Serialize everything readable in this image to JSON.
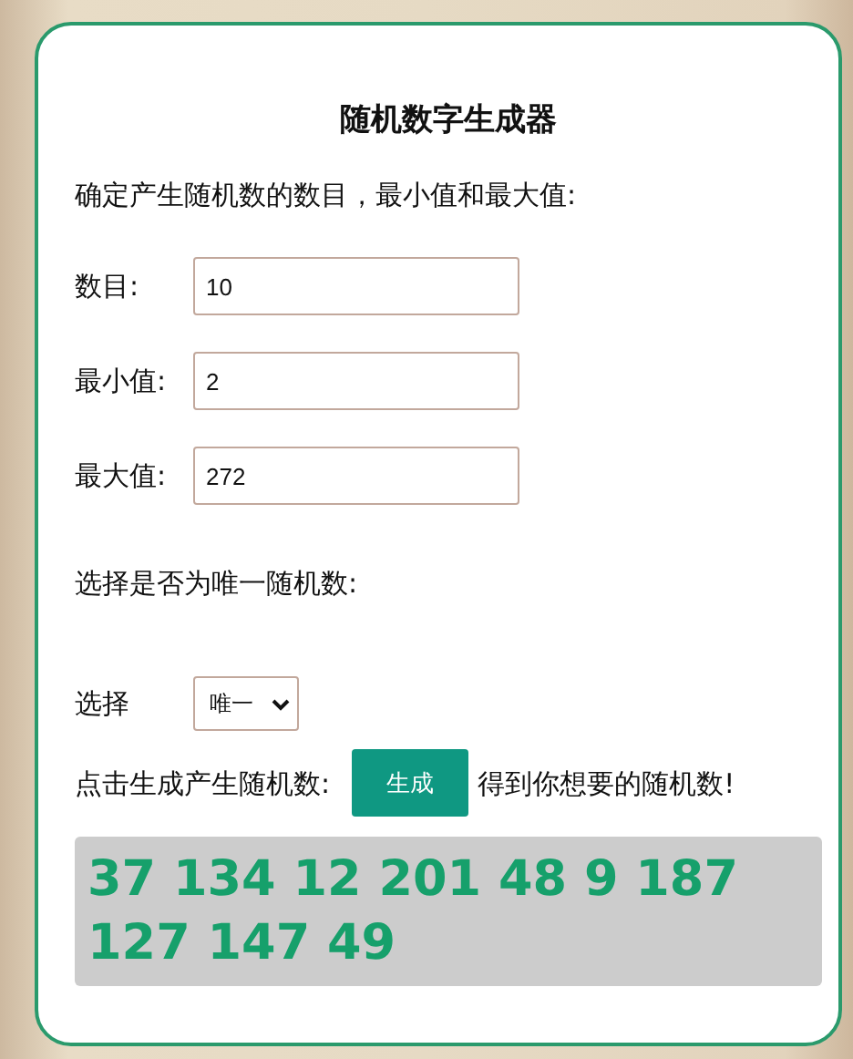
{
  "title": "随机数字生成器",
  "intro": "确定产生随机数的数目，最小值和最大值:",
  "fields": [
    {
      "label": "数目:",
      "value": "10"
    },
    {
      "label": "最小值:",
      "value": "2"
    },
    {
      "label": "最大值:",
      "value": "272"
    }
  ],
  "unique_prompt": "选择是否为唯一随机数:",
  "select": {
    "label": "选择",
    "value": "唯一"
  },
  "generate": {
    "before": "点击生成产生随机数:",
    "button": "生成",
    "after": "得到你想要的随机数!"
  },
  "result": "37 134 12 201 48 9 187 127 147 49"
}
